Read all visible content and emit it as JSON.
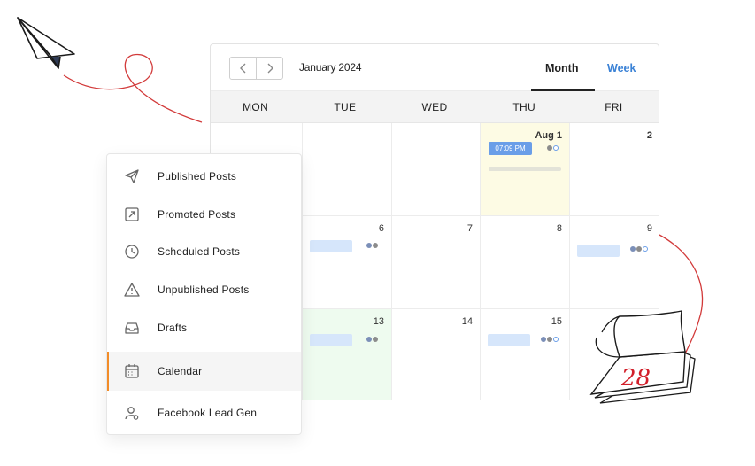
{
  "calendar": {
    "month_label": "January 2024",
    "tabs": {
      "month": "Month",
      "week": "Week"
    },
    "weekdays": [
      "MON",
      "TUE",
      "WED",
      "THU",
      "FRI"
    ],
    "days": {
      "thu_r1": "Aug 1",
      "fri_r1": "2",
      "tue_r2": "6",
      "wed_r2": "7",
      "thu_r2": "8",
      "fri_r2": "9",
      "tue_r3": "13",
      "wed_r3": "14",
      "thu_r3": "15"
    },
    "event_time": "07:09 PM"
  },
  "menu": {
    "items": [
      {
        "label": "Published Posts",
        "icon": "paper-plane-icon"
      },
      {
        "label": "Promoted Posts",
        "icon": "arrow-up-right-box-icon"
      },
      {
        "label": "Scheduled Posts",
        "icon": "clock-icon"
      },
      {
        "label": "Unpublished Posts",
        "icon": "warning-icon"
      },
      {
        "label": "Drafts",
        "icon": "inbox-tray-icon"
      },
      {
        "label": "Calendar",
        "icon": "calendar-icon",
        "active": true
      },
      {
        "label": "Facebook Lead Gen",
        "icon": "user-gear-icon"
      }
    ]
  },
  "illustration": {
    "tearoff_number": "28"
  },
  "colors": {
    "accent": "#3b82d6",
    "active_marker": "#f28c28",
    "event_pill": "#6a9ee8",
    "doodle_red": "#d23a3a"
  }
}
